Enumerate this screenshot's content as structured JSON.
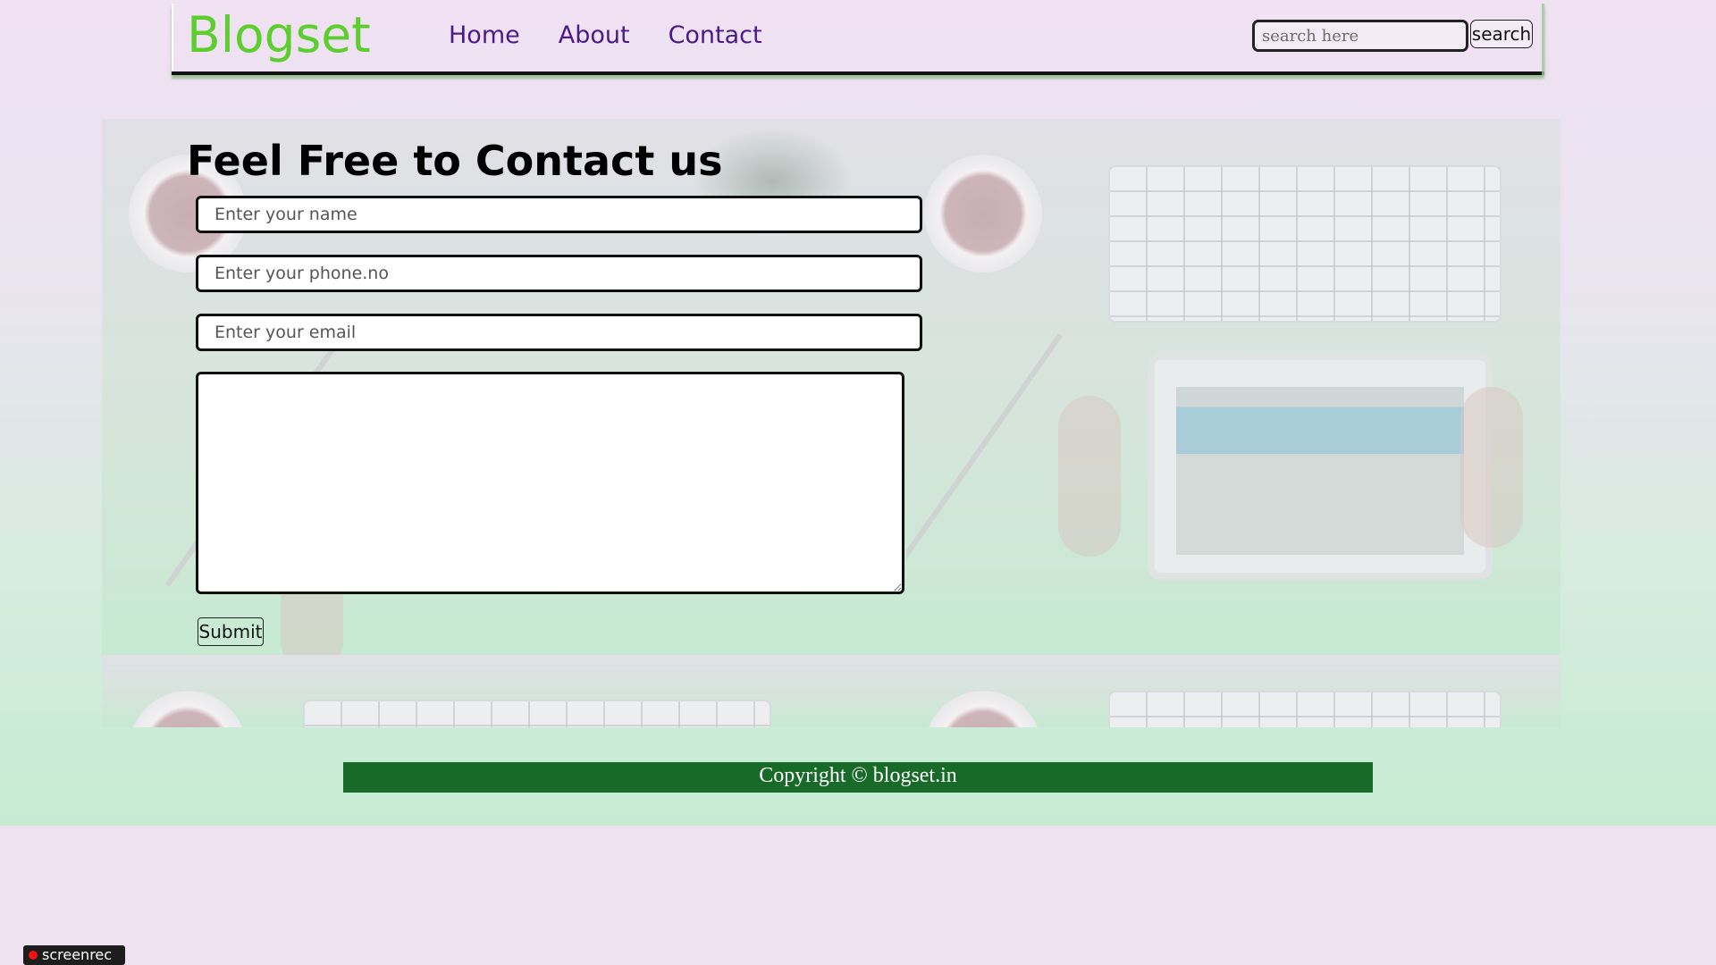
{
  "header": {
    "brand": "Blogset",
    "nav": [
      {
        "label": "Home"
      },
      {
        "label": "About"
      },
      {
        "label": "Contact"
      }
    ],
    "search": {
      "placeholder": "search here",
      "value": "",
      "button_label": "search"
    }
  },
  "contact": {
    "title": "Feel Free to Contact us",
    "name_placeholder": "Enter your name",
    "phone_placeholder": "Enter your phone.no",
    "email_placeholder": "Enter your email",
    "message_value": "",
    "submit_label": "Submit"
  },
  "footer": {
    "text": "Copyright © blogset.in"
  },
  "recorder": {
    "label": "screenrec"
  },
  "colors": {
    "brand": "#5ccf2f",
    "nav_link": "#4a1a8a",
    "footer_bg": "#186a28",
    "page_bg": "#efe3f2"
  }
}
